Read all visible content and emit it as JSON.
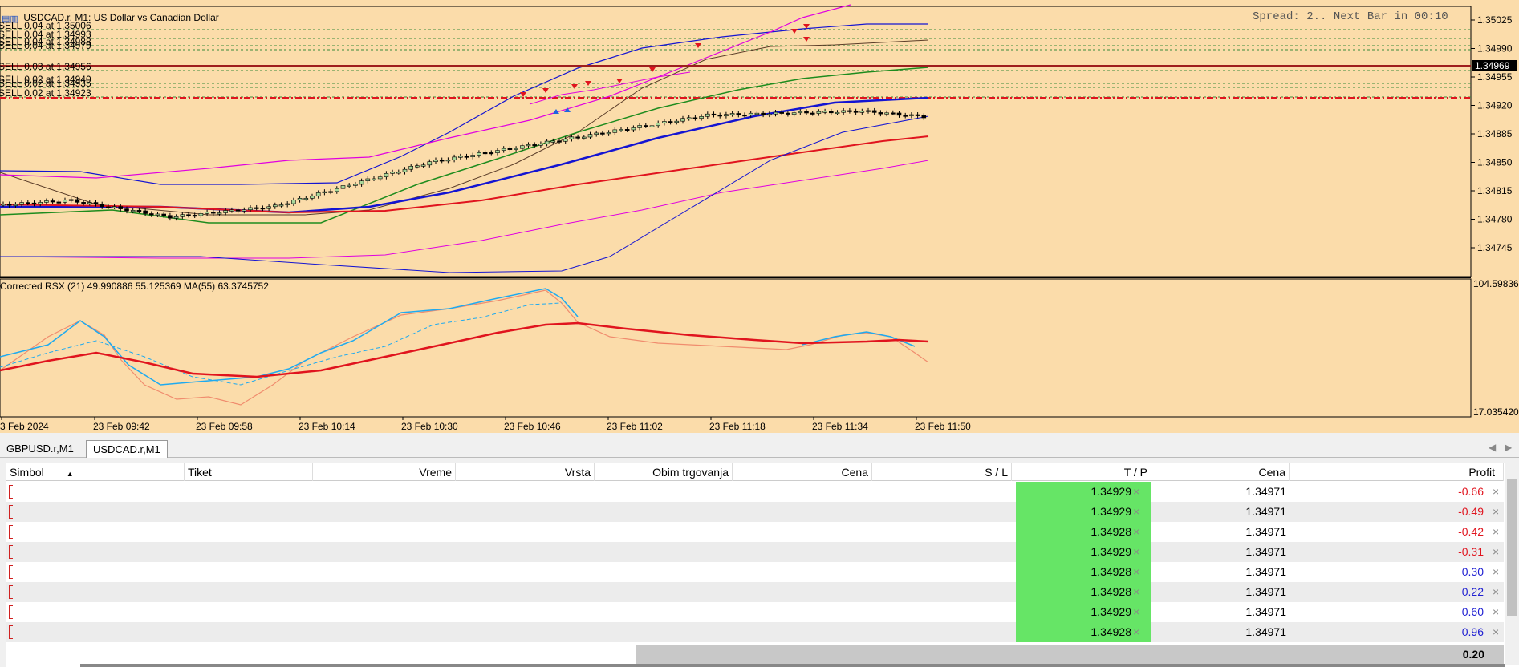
{
  "chart": {
    "title": "USDCAD.r, M1:  US Dollar vs Canadian Dollar",
    "spread_text": "Spread: 2.. Next Bar in 00:10",
    "current_price": "1.34969",
    "price_axis": [
      "1.35025",
      "1.34990",
      "1.34955",
      "1.34920",
      "1.34885",
      "1.34850",
      "1.34815",
      "1.34780",
      "1.34745"
    ],
    "orders": [
      "SELL 0.04 at 1.35006",
      "SELL 0.04 at 1.34993",
      "SELL 0.04 at 1.34988",
      "SELL 0.04 at 1.34979",
      "SELL 0.03 at 1.34956",
      "SELL 0.02 at 1.34940",
      "SELL 0.02 at 1.34935",
      "SELL 0.02 at 1.34923"
    ],
    "indicator_label": "Corrected RSX (21) 49.990886 55.125369 MA(55) 63.3745752",
    "indicator_axis_max": "104.59836",
    "indicator_axis_min": "17.035420",
    "time_axis": [
      "3 Feb 2024",
      "23 Feb 09:42",
      "23 Feb 09:58",
      "23 Feb 10:14",
      "23 Feb 10:30",
      "23 Feb 10:46",
      "23 Feb 11:02",
      "23 Feb 11:18",
      "23 Feb 11:34",
      "23 Feb 11:50"
    ],
    "colors": {
      "background": "#fbdcaa",
      "bull": "#a8d89a",
      "bear": "#000000",
      "red": "#e0141e",
      "green": "#1e8c1e",
      "blue": "#1414d2",
      "magenta": "#e000e0",
      "cyan": "#1eaaf0",
      "salmon": "#f08c6e"
    }
  },
  "tabs": [
    {
      "label": "GBPUSD.r,M1"
    },
    {
      "label": "USDCAD.r,M1"
    }
  ],
  "table": {
    "headers": {
      "symbol": "Simbol",
      "ticket": "Tiket",
      "time": "Vreme",
      "type": "Vrsta",
      "volume": "Obim trgovanja",
      "price": "Cena",
      "sl": "S / L",
      "tp": "T / P",
      "cur_price": "Cena",
      "profit": "Profit"
    },
    "rows": [
      {
        "tp": "1.34929",
        "price": "1.34971",
        "profit": "-0.66",
        "sign": "neg"
      },
      {
        "tp": "1.34929",
        "price": "1.34971",
        "profit": "-0.49",
        "sign": "neg"
      },
      {
        "tp": "1.34928",
        "price": "1.34971",
        "profit": "-0.42",
        "sign": "neg"
      },
      {
        "tp": "1.34929",
        "price": "1.34971",
        "profit": "-0.31",
        "sign": "neg"
      },
      {
        "tp": "1.34928",
        "price": "1.34971",
        "profit": "0.30",
        "sign": "pos"
      },
      {
        "tp": "1.34928",
        "price": "1.34971",
        "profit": "0.22",
        "sign": "pos"
      },
      {
        "tp": "1.34929",
        "price": "1.34971",
        "profit": "0.60",
        "sign": "pos"
      },
      {
        "tp": "1.34928",
        "price": "1.34971",
        "profit": "0.96",
        "sign": "pos"
      }
    ],
    "total": "0.20"
  }
}
